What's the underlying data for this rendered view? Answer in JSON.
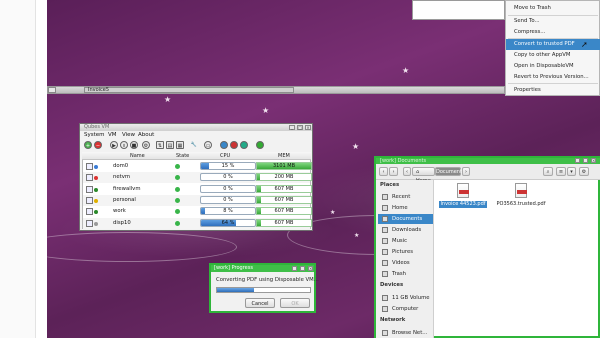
{
  "taskbar": {
    "active_window": "Invoice5"
  },
  "context_menu": {
    "items": [
      {
        "label": "Move to Trash",
        "selected": false
      },
      {
        "label": "Send To...",
        "selected": false
      },
      {
        "label": "Compress...",
        "selected": false
      },
      {
        "label": "Convert to trusted PDF",
        "selected": true
      },
      {
        "label": "Copy to other AppVM",
        "selected": false
      },
      {
        "label": "Open in DisposableVM",
        "selected": false
      },
      {
        "label": "Revert to Previous Version...",
        "selected": false
      },
      {
        "label": "Properties",
        "selected": false
      }
    ]
  },
  "qubes_manager": {
    "title": "Qubes VM",
    "menus": [
      "System",
      "VM",
      "View",
      "About"
    ],
    "columns": {
      "name": "Name",
      "state": "State",
      "cpu": "CPU",
      "mem": "MEM"
    },
    "vms": [
      {
        "name": "dom0",
        "cpu": "15 %",
        "cpu_frac": 0.15,
        "mem": "3101 MB",
        "mem_frac": 1.0,
        "color": "#3a7bd5"
      },
      {
        "name": "netvm",
        "cpu": "0 %",
        "cpu_frac": 0.0,
        "mem": "200 MB",
        "mem_frac": 0.06,
        "color": "#d33"
      },
      {
        "name": "firewallvm",
        "cpu": "0 %",
        "cpu_frac": 0.0,
        "mem": "607 MB",
        "mem_frac": 0.07,
        "color": "#2b8a2b"
      },
      {
        "name": "personal",
        "cpu": "0 %",
        "cpu_frac": 0.0,
        "mem": "607 MB",
        "mem_frac": 0.07,
        "color": "#e0b000"
      },
      {
        "name": "work",
        "cpu": "8 %",
        "cpu_frac": 0.08,
        "mem": "607 MB",
        "mem_frac": 0.07,
        "color": "#2b8a2b"
      },
      {
        "name": "disp10",
        "cpu": "64 %",
        "cpu_frac": 0.64,
        "mem": "607 MB",
        "mem_frac": 0.07,
        "color": "#999"
      }
    ]
  },
  "progress_dialog": {
    "title": "[work] Progress",
    "message": "Converting PDF using Disposable VM...",
    "progress": 0.4,
    "cancel_label": "Cancel",
    "ok_label": "OK"
  },
  "file_manager": {
    "title": "[work] Documents",
    "path": [
      "Home",
      "Documents"
    ],
    "sidebar": {
      "places_label": "Places",
      "places": [
        {
          "label": "Recent",
          "selected": false
        },
        {
          "label": "Home",
          "selected": false
        },
        {
          "label": "Documents",
          "selected": true
        },
        {
          "label": "Downloads",
          "selected": false
        },
        {
          "label": "Music",
          "selected": false
        },
        {
          "label": "Pictures",
          "selected": false
        },
        {
          "label": "Videos",
          "selected": false
        },
        {
          "label": "Trash",
          "selected": false
        }
      ],
      "devices_label": "Devices",
      "devices": [
        {
          "label": "11 GB Volume"
        },
        {
          "label": "Computer"
        }
      ],
      "network_label": "Network",
      "network": [
        {
          "label": "Browse Net..."
        }
      ]
    },
    "files": [
      {
        "name": "Invoice 44523.pdf",
        "selected": true
      },
      {
        "name": "PO3563.trusted.pdf",
        "selected": false
      }
    ]
  }
}
